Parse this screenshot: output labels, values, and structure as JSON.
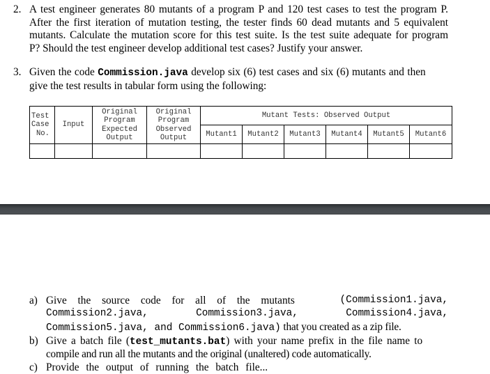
{
  "question2": {
    "number": "2.",
    "lines": [
      "A test engineer generates 80 mutants of a program P and 120 test cases to test the program P.",
      "After the first iteration of mutation testing, the tester finds 60 dead mutants and 5 equivalent",
      "mutants. Calculate the mutation score for this test suite. Is the test suite adequate for program",
      "P?  Should the test engineer develop additional test cases?  Justify your answer."
    ]
  },
  "question3": {
    "number": "3.",
    "line1_pre": "Given the code ",
    "line1_code": "Commission.java",
    "line1_post": " develop six (6) test cases and six (6) mutants and then",
    "line2": "give the test results in tabular form using the following:"
  },
  "table": {
    "headers": {
      "test_case": [
        "Test",
        "Case",
        "No."
      ],
      "input": "Input",
      "expected": [
        "Original",
        "Program",
        "Expected",
        "Output"
      ],
      "observed": [
        "Original",
        "Program",
        "Observed",
        "Output"
      ],
      "mutant_group": "Mutant Tests: Observed Output",
      "mutants": [
        "Mutant1",
        "Mutant2",
        "Mutant3",
        "Mutant4",
        "Mutant5",
        "Mutant6"
      ]
    },
    "rows": [
      [
        "",
        "",
        "",
        "",
        "",
        "",
        "",
        "",
        "",
        ""
      ]
    ]
  },
  "parts": {
    "a": {
      "label": "a)",
      "line1_text": "Give the source code for all of the mutants",
      "line1_code": "(Commission1.java,",
      "line2_codes": [
        "Commission2.java,",
        "Commission3.java,",
        "Commission4.java,"
      ],
      "line3_code1": "Commission5.java, and Commission6.java)",
      "line3_text": " that you created as a zip file."
    },
    "b": {
      "label": "b)",
      "line1_pre": "Give a batch file (",
      "line1_code": "test_mutants.bat",
      "line1_post": ") with your name prefix in the file name to",
      "line2": "compile and run all the mutants and the original (unaltered) code automatically."
    },
    "c": {
      "label": "c)",
      "line1_partial": "Provide the output of running the batch file..."
    }
  }
}
